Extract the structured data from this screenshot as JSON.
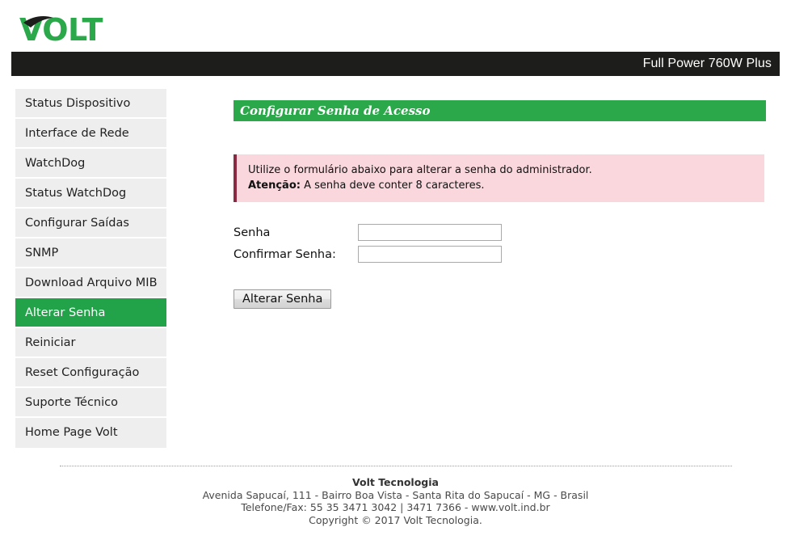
{
  "brand": {
    "logo_text": "VOLT",
    "logo_color": "#2aa84a",
    "logo_swoosh_color": "#1d1d1b"
  },
  "header": {
    "device_title": "Full Power 760W Plus",
    "bar_color": "#1d1d1b"
  },
  "sidebar": {
    "active_color": "#22a349",
    "items": [
      {
        "label": "Status Dispositivo",
        "active": false
      },
      {
        "label": "Interface de Rede",
        "active": false
      },
      {
        "label": "WatchDog",
        "active": false
      },
      {
        "label": "Status WatchDog",
        "active": false
      },
      {
        "label": "Configurar Saídas",
        "active": false
      },
      {
        "label": "SNMP",
        "active": false
      },
      {
        "label": "Download Arquivo MIB",
        "active": false
      },
      {
        "label": "Alterar Senha",
        "active": true
      },
      {
        "label": "Reiniciar",
        "active": false
      },
      {
        "label": "Reset Configuração",
        "active": false
      },
      {
        "label": "Suporte Técnico",
        "active": false
      },
      {
        "label": "Home Page Volt",
        "active": false
      }
    ]
  },
  "main": {
    "panel_title": "Configurar Senha de Acesso",
    "panel_title_color": "#2aa84a",
    "alert": {
      "background": "#f9d7dd",
      "accent": "#8b2942",
      "line1": "Utilize o formulário abaixo para alterar a senha do administrador.",
      "line2_strong": "Atenção:",
      "line2_rest": " A senha deve conter 8 caracteres."
    },
    "form": {
      "password_label": "Senha",
      "password_value": "",
      "password_placeholder": "",
      "confirm_label": "Confirmar Senha:",
      "confirm_value": "",
      "confirm_placeholder": "",
      "submit_label": "Alterar Senha"
    }
  },
  "footer": {
    "company": "Volt Tecnologia",
    "address": "Avenida Sapucaí, 111 - Bairro Boa Vista - Santa Rita do Sapucaí - MG - Brasil",
    "contact": "Telefone/Fax: 55 35 3471 3042 | 3471 7366 - www.volt.ind.br",
    "copyright": "Copyright © 2017 Volt Tecnologia."
  }
}
